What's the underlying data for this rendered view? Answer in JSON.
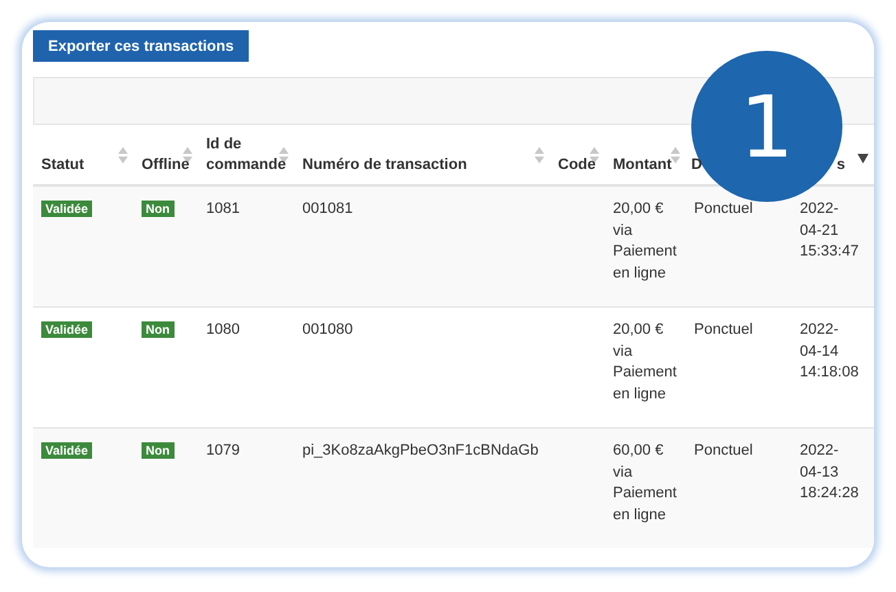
{
  "export_button": "Exporter ces transactions",
  "step_badge": "1",
  "table": {
    "columns": [
      {
        "label": "Statut",
        "sorted": false
      },
      {
        "label": "Offline",
        "sorted": false
      },
      {
        "label": "Id de commande",
        "sorted": false
      },
      {
        "label": "Numéro de transaction",
        "sorted": false
      },
      {
        "label": "Code",
        "sorted": false
      },
      {
        "label": "Montant",
        "sorted": false
      },
      {
        "label": "D"
      },
      {
        "label": "s",
        "sorted": true
      }
    ],
    "rows": [
      {
        "status": "Validée",
        "offline": "Non",
        "order_id": "1081",
        "transaction": "001081",
        "amount": "20,00 € via Paiement en ligne",
        "column_7": "Ponctuel",
        "column_8": "2022-04-21 15:33:47"
      },
      {
        "status": "Validée",
        "offline": "Non",
        "order_id": "1080",
        "transaction": "001080",
        "amount": "20,00 € via Paiement en ligne",
        "column_7": "Ponctuel",
        "column_8": "2022-04-14 14:18:08"
      },
      {
        "status": "Validée",
        "offline": "Non",
        "order_id": "1079",
        "transaction": "pi_3Ko8zaAkgPbeO3nF1cBNdaGb",
        "amount": "60,00 € via Paiement en ligne",
        "column_7": "Ponctuel",
        "column_8": "2022-04-13 18:24:28"
      }
    ]
  }
}
